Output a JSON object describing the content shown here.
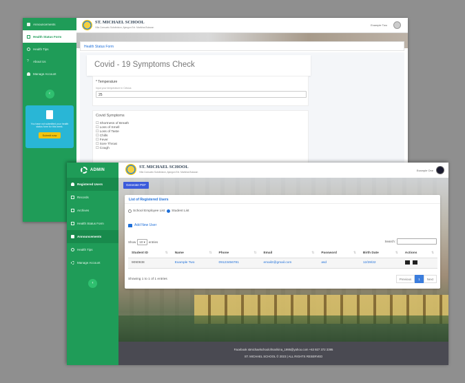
{
  "back_window": {
    "sidebar": {
      "items": [
        {
          "label": "Announcements",
          "icon": "announcement-icon",
          "active": false
        },
        {
          "label": "Health Status Form",
          "icon": "form-icon",
          "active": true
        },
        {
          "label": "Health Tips",
          "icon": "eye-icon",
          "active": false
        },
        {
          "label": "About Us",
          "icon": "question-icon",
          "active": false
        },
        {
          "label": "Manage Account",
          "icon": "user-icon",
          "active": false
        }
      ],
      "collapse_glyph": "‹",
      "promo": {
        "text": "You have not submitted your health status form for this week.",
        "button": "Submit now"
      }
    },
    "header": {
      "school_name": "ST. MICHAEL SCHOOL",
      "address": "Villa Consuelo Subdivision, Ajangon Ext. Marikina Bulacan",
      "user_name": "Example Two"
    },
    "section_title": "Health Status Form",
    "card_title": "Covid - 19 Symptoms Check",
    "temperature": {
      "label": "* Temperature",
      "hint": "Input your temperature in Celsius",
      "value": "25"
    },
    "symptoms": {
      "title": "Covid Symptoms",
      "options": [
        "☐ Shortness of Breath",
        "☐ Loss of Smell",
        "☐ Loss of Taste",
        "☐ Chills",
        "☐ Fever",
        "☐ Sore Throat",
        "☐ Cough"
      ]
    }
  },
  "front_window": {
    "brand": "ADMIN",
    "sidebar": {
      "items": [
        {
          "label": "Registered Users",
          "icon": "users-icon",
          "active": true
        },
        {
          "label": "Records",
          "icon": "records-icon",
          "active": false
        },
        {
          "label": "Archives",
          "icon": "archive-icon",
          "active": false
        },
        {
          "label": "Health Status Form",
          "icon": "form-icon",
          "active": false
        },
        {
          "label": "Announcements",
          "icon": "announcement-icon",
          "active": true
        },
        {
          "label": "Health Tips",
          "icon": "eye-icon",
          "active": false
        },
        {
          "label": "Manage Account",
          "icon": "settings-icon",
          "active": false
        }
      ],
      "collapse_glyph": "‹"
    },
    "header": {
      "school_name": "ST. MICHAEL SCHOOL",
      "address": "Villa Consuelo Subdivision, Ajangon Ext. Marikina Bulacan",
      "user_name": "Example One"
    },
    "generate_pdf": "Generate PDF",
    "panel_title": "List of Registered Users",
    "radios": [
      {
        "label": "School Employee List",
        "checked": false
      },
      {
        "label": "Student List",
        "checked": true
      }
    ],
    "add_user": "Add New User",
    "show_prefix": "Show",
    "show_value": "10",
    "show_suffix": "entries",
    "search_label": "Search:",
    "table": {
      "columns": [
        "Student ID",
        "Name",
        "Phone",
        "Email",
        "Password",
        "Birth Date",
        "Actions"
      ],
      "rows": [
        {
          "id": "9090938",
          "name": "Example Two",
          "phone": "09123456781",
          "email": "email2@gmail.com",
          "password": "asd",
          "birth_date": "12/28/22"
        }
      ]
    },
    "showing": "Showing 1 to 1 of 1 entries",
    "pager": {
      "prev": "Previous",
      "current": "1",
      "next": "Next"
    },
    "footer": {
      "line1": "Facebook   stmichaelschoolofmarikina_1995@yahoo.com   +63 927 372 3395",
      "line2": "ST. MICHAEL SCHOOL © 2023 | ALL RIGHTS RESERVED"
    }
  },
  "colors": {
    "sidebar_green": "#1f9c58",
    "accent_blue": "#1e6fd9",
    "promo_cyan": "#29b6d6",
    "promo_button": "#f1c40f",
    "footer_bg": "#4a4a52"
  }
}
